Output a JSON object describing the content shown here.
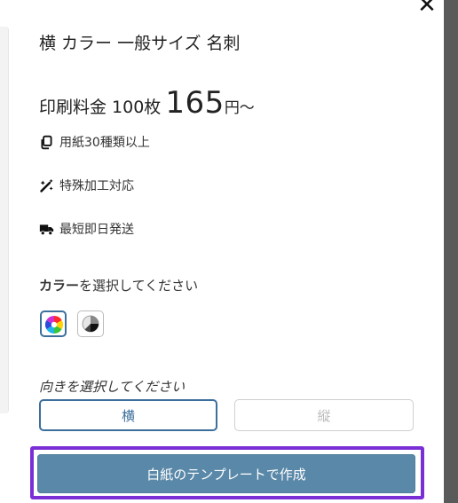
{
  "modal": {
    "close_symbol": "✕",
    "title": "横 カラー 一般サイズ 名刺",
    "price": {
      "label": "印刷料金 100枚",
      "amount": "165",
      "unit": "円〜"
    },
    "features": [
      {
        "icon": "copy-icon",
        "label": "用紙30種類以上"
      },
      {
        "icon": "magic-wand-icon",
        "label": "特殊加工対応"
      },
      {
        "icon": "delivery-truck-icon",
        "label": "最短即日発送"
      }
    ],
    "color_section": {
      "label_bold": "カラー",
      "label_rest": "を選択してください",
      "options": [
        {
          "icon": "full-color-wheel-icon",
          "selected": true
        },
        {
          "icon": "monochrome-wheel-icon",
          "selected": false
        }
      ]
    },
    "orientation_section": {
      "label": "向きを選択してください",
      "options": [
        {
          "label": "横",
          "selected": true
        },
        {
          "label": "縦",
          "selected": false
        }
      ]
    },
    "cta_label": "白紙のテンプレートで作成"
  },
  "colors": {
    "accent": "#3c6f9c",
    "cta_background": "#5a88a8",
    "highlight_outline": "#7a2fd6"
  }
}
